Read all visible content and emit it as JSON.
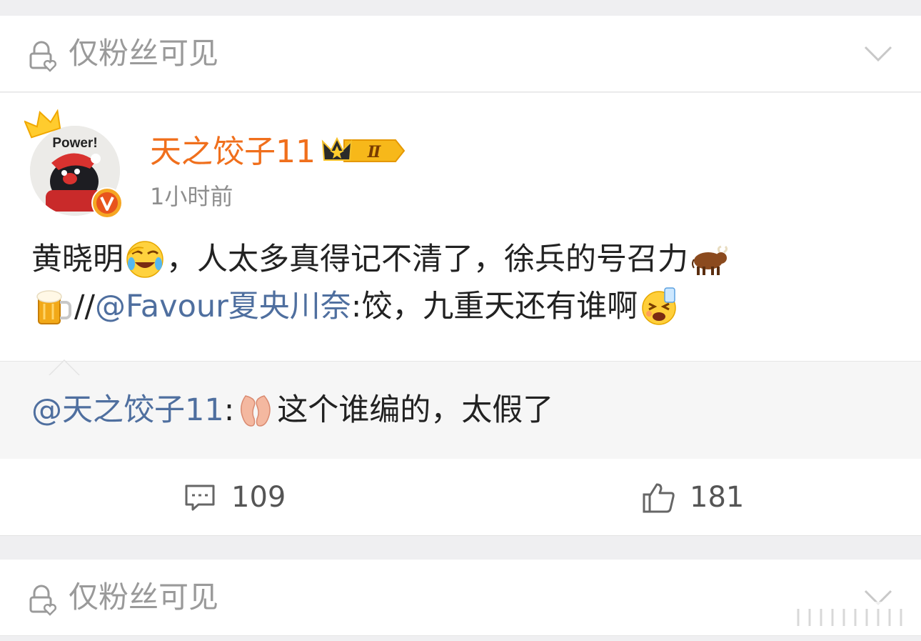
{
  "top_visibility": {
    "label": "仅粉丝可见"
  },
  "post": {
    "username": "天之饺子11",
    "vip_level": "Ⅱ",
    "avatar_text": "Power!",
    "timestamp": "1小时前",
    "content": {
      "line1_a": "黄晓明",
      "line1_b": "，人太多真得记不清了，徐兵的号召力",
      "line2_a": "//",
      "line2_mention": "@Favour夏央川奈",
      "line2_b": ":饺，九重天还有谁啊"
    },
    "emojis": [
      "laugh-cry-emoji",
      "ox-emoji",
      "beer-emoji",
      "drunk-emoji",
      "ear-emoji"
    ],
    "repost": {
      "mention": "@天之饺子11",
      "text": "这个谁编的，太假了"
    },
    "actions": {
      "comments": "109",
      "likes": "181"
    },
    "colors": {
      "username": "#f06f1c",
      "mention": "#4f6f9f"
    }
  },
  "bottom_visibility": {
    "label": "仅粉丝可见"
  }
}
